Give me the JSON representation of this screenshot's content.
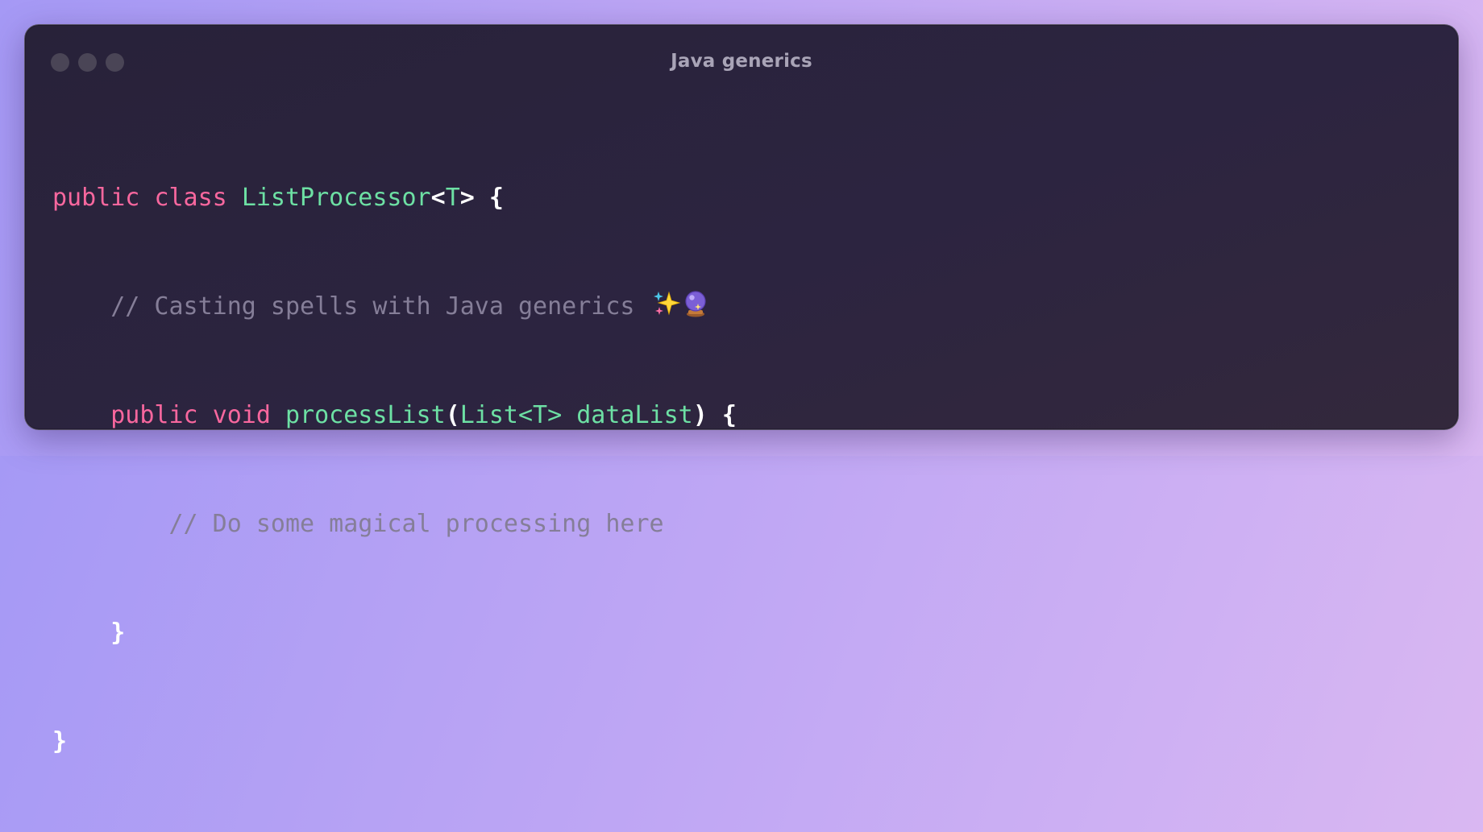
{
  "window": {
    "title": "Java generics"
  },
  "code": {
    "line1": {
      "kw_public": "public",
      "kw_class": "class",
      "class_name": "ListProcessor",
      "type_open": "<",
      "type_param": "T",
      "type_close": ">",
      "brace": "{"
    },
    "line2": {
      "comment": "// Casting spells with Java generics"
    },
    "line3": {
      "kw_public": "public",
      "kw_void": "void",
      "method_name": "processList",
      "paren_open": "(",
      "param_type": "List<T>",
      "param_name": "dataList",
      "paren_close": ")",
      "brace": "{"
    },
    "line4": {
      "comment": "// Do some magical processing here"
    },
    "line5": {
      "brace": "}"
    },
    "line6": {
      "brace": "}"
    }
  },
  "icons": {
    "sparkles": "sparkles-emoji",
    "crystal_ball": "crystal-ball-emoji"
  },
  "colors": {
    "keyword": "#f8679e",
    "type": "#6de0a4",
    "comment": "#857e98",
    "plain": "#ffffff"
  }
}
